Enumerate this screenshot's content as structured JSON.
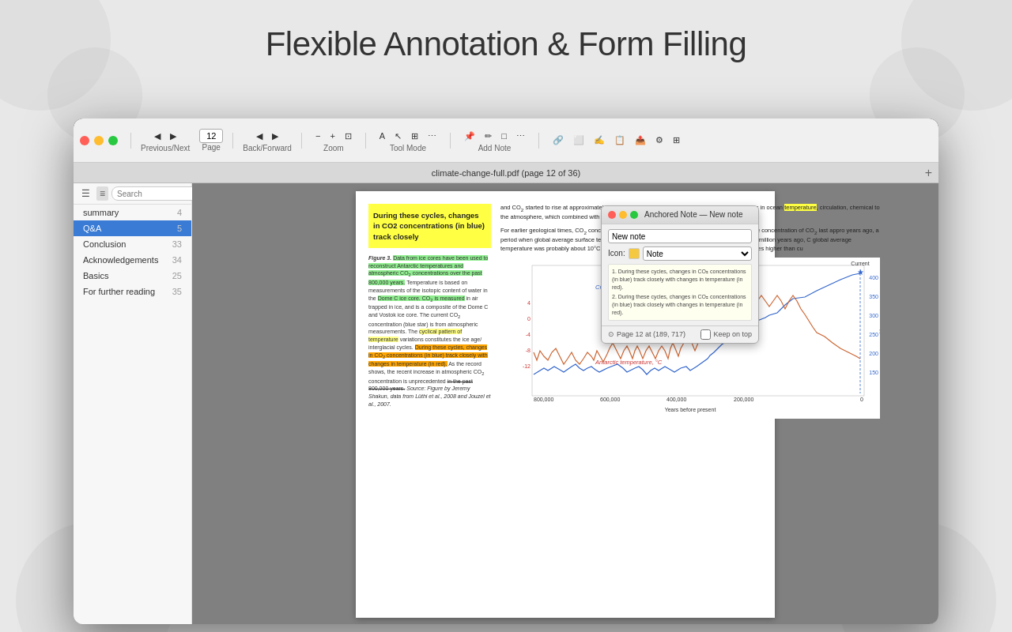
{
  "page": {
    "title": "Flexible Annotation & Form Filling",
    "window_title": "climate-change-full.pdf (page 12 of 36)",
    "tab_label": "climate-change-full.pdf (page 12 of 36)"
  },
  "toolbar": {
    "prev_next": "Previous/Next",
    "page_label": "Page",
    "page_number": "12",
    "back_forward": "Back/Forward",
    "zoom_label": "Zoom",
    "tool_mode": "Tool Mode",
    "add_note": "Add Note"
  },
  "sidebar": {
    "search_placeholder": "Search",
    "items": [
      {
        "label": "summary",
        "count": "4"
      },
      {
        "label": "Q&A",
        "count": "5"
      },
      {
        "label": "Conclusion",
        "count": "33"
      },
      {
        "label": "Acknowledgements",
        "count": "34"
      },
      {
        "label": "Basics",
        "count": "25"
      },
      {
        "label": "For further reading",
        "count": "35"
      }
    ]
  },
  "pdf": {
    "highlight_box_text": "During these cycles, changes in CO2 concentrations (in blue) track closely",
    "figure_caption_label": "Figure 3.",
    "figure_caption_text": "Data from ice cores have been used to reconstruct Antarctic temperatures and atmospheric CO2 concentrations over the past 800,000 years. Temperature is based on measurements of the isotopic content of water in the Dome C ice core. CO2 is measured in air trapped in ice, and is a composite of the Dome C and Vostok ice core. The current CO2 concentration (blue star) is from atmospheric measurements. The cyclical pattern of temperature variations constitutes the ice age/ interglacial cycles. During these cycles, changes in CO2 concentrations (in blue) track closely with changes in temperature (in red). As the record shows, the recent increase in atmospheric CO2 concentration is unprecedented in the past 800,000 years. Source: Figure by Jeremy Shakun, data from Lüthi et al., 2008 and Jouzel et al., 2007.",
    "right_col_text_1": "and CO2 started to rise at approximately the same time and continu 11,000 years ago. Changes in ocean temperature, circulation, chemi to the atmosphere, which combined with other feedbacks to push b",
    "right_col_text_2": "For earlier geological times, CO2 concentrations and temperature methods. Those suggest that the concentration of CO2 last appro years ago, a period when global average surface temperature is e higher than in the pre-industrial period. At 50 million years ago, C global average temperature was probably about 10°C warmer tha had little ice, and sea level was at least 60 metres higher than cu",
    "chart": {
      "title_co2": "CO2 concentration, ppm",
      "title_temp": "Antarctic temperature, °C",
      "x_label": "Years before present",
      "x_ticks": [
        "800,000",
        "600,000",
        "400,000",
        "200,000",
        "0"
      ],
      "y_right_ticks": [
        "400",
        "350",
        "300",
        "250",
        "200",
        "150"
      ],
      "y_left_ticks": [
        "4",
        "0",
        "-4",
        "-8",
        "-12"
      ]
    }
  },
  "anchored_note": {
    "title": "Anchored Note — New note",
    "input_placeholder": "New note",
    "icon_label": "Icon:",
    "icon_value": "Note",
    "content_line1": "1. During these cycles, changes in CO2 concentrations (in blue) track closely with changes in temperature (in red).",
    "content_line2": "2. During these cycles, changes in CO2 concentrations (in blue) track closely with changes in temperature (in red).",
    "page_info": "Page 12 at (189, 717)",
    "keep_on_top": "Keep on top"
  }
}
